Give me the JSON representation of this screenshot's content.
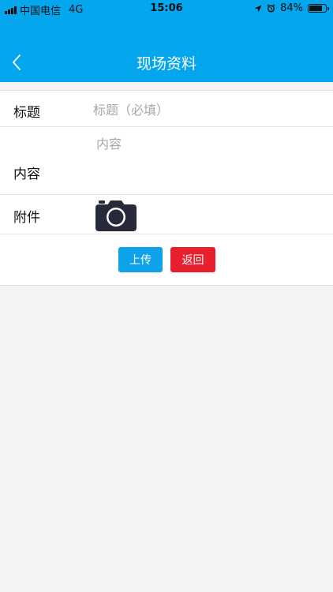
{
  "status_bar": {
    "carrier": "中国电信",
    "network": "4G",
    "time": "15:06",
    "battery": "84%",
    "battery_level": 0.84
  },
  "header": {
    "title": "现场资料",
    "back_icon": "chevron-left-icon"
  },
  "form": {
    "title": {
      "label": "标题",
      "placeholder": "标题（必填）",
      "value": ""
    },
    "content": {
      "label": "内容",
      "placeholder": "内容",
      "value": ""
    },
    "attachment": {
      "label": "附件",
      "icon": "camera-icon"
    }
  },
  "actions": {
    "upload_label": "上传",
    "back_label": "返回"
  },
  "colors": {
    "header_bg": "#04a6ee",
    "upload_button": "#0ea2ea",
    "back_button": "#e8202e",
    "page_bg": "#f4f4f4"
  }
}
